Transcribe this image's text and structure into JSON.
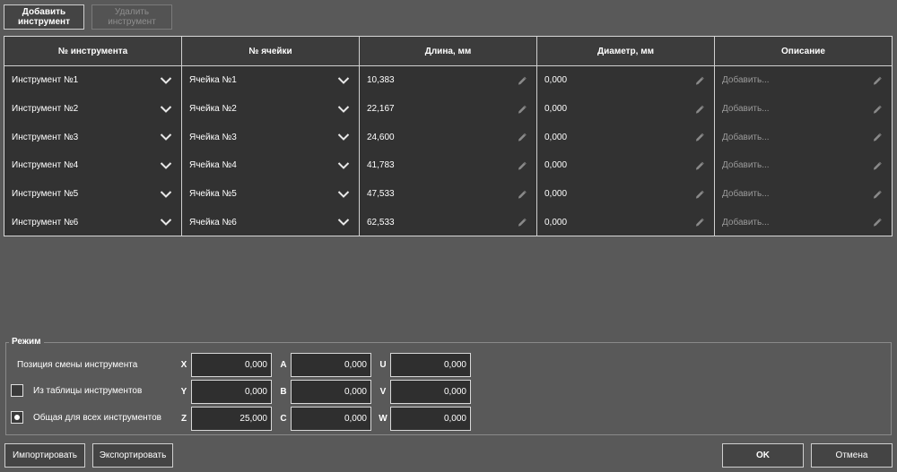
{
  "toolbar": {
    "add_label": "Добавить\nинструмент",
    "remove_label": "Удалить\nинструмент"
  },
  "table": {
    "headers": [
      "№ инструмента",
      "№ ячейки",
      "Длина, мм",
      "Диаметр, мм",
      "Описание"
    ],
    "rows": [
      {
        "tool": "Инструмент №1",
        "cell": "Ячейка №1",
        "length": "10,383",
        "diameter": "0,000",
        "description": "Добавить..."
      },
      {
        "tool": "Инструмент №2",
        "cell": "Ячейка №2",
        "length": "22,167",
        "diameter": "0,000",
        "description": "Добавить..."
      },
      {
        "tool": "Инструмент №3",
        "cell": "Ячейка №3",
        "length": "24,600",
        "diameter": "0,000",
        "description": "Добавить..."
      },
      {
        "tool": "Инструмент №4",
        "cell": "Ячейка №4",
        "length": "41,783",
        "diameter": "0,000",
        "description": "Добавить..."
      },
      {
        "tool": "Инструмент №5",
        "cell": "Ячейка №5",
        "length": "47,533",
        "diameter": "0,000",
        "description": "Добавить..."
      },
      {
        "tool": "Инструмент №6",
        "cell": "Ячейка №6",
        "length": "62,533",
        "diameter": "0,000",
        "description": "Добавить..."
      }
    ]
  },
  "mode": {
    "title": "Режим",
    "position_label": "Позиция смены инструмента",
    "from_table_label": "Из таблицы инструментов",
    "from_table_checked": false,
    "common_label": "Общая для всех инструментов",
    "common_selected": true,
    "axes": {
      "x": {
        "label": "X",
        "value": "0,000"
      },
      "y": {
        "label": "Y",
        "value": "0,000"
      },
      "z": {
        "label": "Z",
        "value": "25,000"
      },
      "a": {
        "label": "A",
        "value": "0,000"
      },
      "b": {
        "label": "B",
        "value": "0,000"
      },
      "c": {
        "label": "C",
        "value": "0,000"
      },
      "u": {
        "label": "U",
        "value": "0,000"
      },
      "v": {
        "label": "V",
        "value": "0,000"
      },
      "w": {
        "label": "W",
        "value": "0,000"
      }
    }
  },
  "footer": {
    "import_label": "Импортировать",
    "export_label": "Экспортировать",
    "ok_label": "OK",
    "cancel_label": "Отмена"
  },
  "colors": {
    "background": "#595959",
    "table_bg": "#323232",
    "border": "#d8d8d8",
    "placeholder": "#9a9a9a"
  },
  "icons": {
    "dropdown": "chevron-down-icon",
    "edit": "pencil-icon",
    "radio": "radio-dot-icon"
  }
}
